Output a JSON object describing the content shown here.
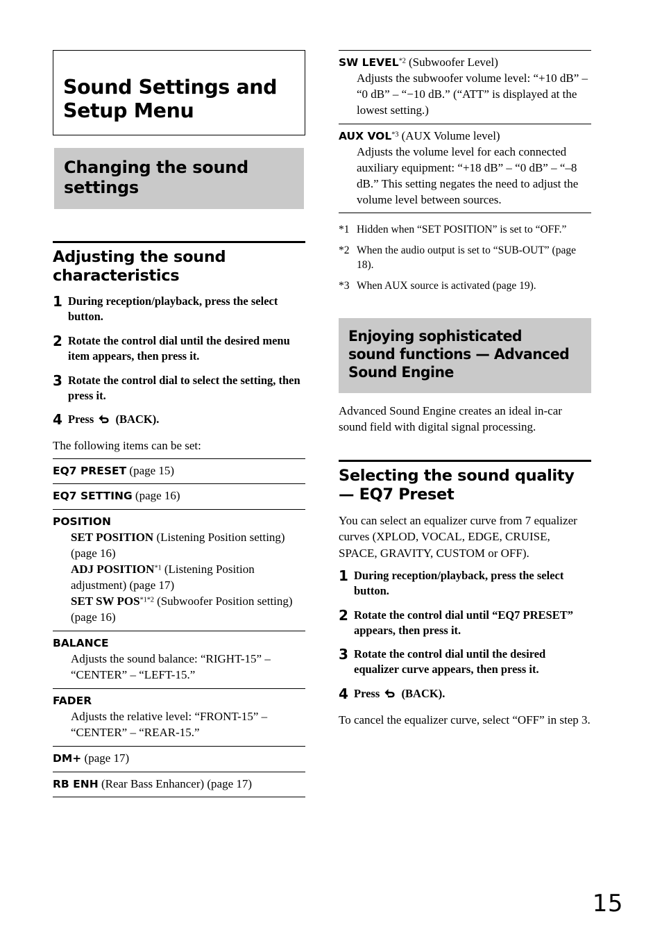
{
  "chapter": {
    "title": "Sound Settings and Setup Menu"
  },
  "left_column": {
    "banner": "Changing the sound settings",
    "section_title": "Adjusting the sound characteristics",
    "steps": [
      {
        "num": "1",
        "text": "During reception/playback, press the select button."
      },
      {
        "num": "2",
        "text": "Rotate the control dial until the desired menu item appears, then press it."
      },
      {
        "num": "3",
        "text": "Rotate the control dial to select the setting, then press it."
      },
      {
        "num": "4",
        "pre": "Press",
        "icon": "back-arrow-icon",
        "post": "(BACK)."
      }
    ],
    "intro": "The following items can be set:",
    "items": [
      {
        "name": "EQ7 PRESET",
        "suffix": " (page 15)",
        "sub": []
      },
      {
        "name": "EQ7 SETTING",
        "suffix": " (page 16)",
        "sub": []
      },
      {
        "name": "POSITION",
        "suffix": "",
        "sub": [
          {
            "label": "SET POSITION",
            "marks": "",
            "text": " (Listening Position setting) (page 16)"
          },
          {
            "label": "ADJ POSITION",
            "marks": "*1",
            "text": " (Listening Position adjustment) (page 17)"
          },
          {
            "label": "SET SW POS",
            "marks": "*1*2",
            "text": " (Subwoofer Position setting) (page 16)"
          }
        ]
      },
      {
        "name": "BALANCE",
        "suffix": "",
        "desc": "Adjusts the sound balance: “RIGHT-15” – “CENTER” – “LEFT-15.”",
        "sub": []
      },
      {
        "name": "FADER",
        "suffix": "",
        "desc": "Adjusts the relative level: “FRONT-15” – “CENTER” – “REAR-15.”",
        "sub": []
      },
      {
        "name": "DM+",
        "suffix": " (page 17)",
        "sub": []
      },
      {
        "name": "RB ENH",
        "suffix": " (Rear Bass Enhancer) (page 17)",
        "sub": []
      }
    ]
  },
  "right_column": {
    "items": [
      {
        "name": "SW LEVEL",
        "marks": "*2",
        "suffix": " (Subwoofer Level)",
        "desc": "Adjusts the subwoofer volume level: “+10 dB” – “0 dB” – “−10 dB.” (“ATT” is displayed at the lowest setting.)"
      },
      {
        "name": "AUX VOL",
        "marks": "*3",
        "suffix": " (AUX Volume level)",
        "desc": "Adjusts the volume level for each connected auxiliary equipment: “+18 dB” – “0 dB” – “–8 dB.” This setting negates the need to adjust the volume level between sources."
      }
    ],
    "footnotes": [
      {
        "mark": "*1",
        "text": "Hidden when “SET POSITION” is set to “OFF.”"
      },
      {
        "mark": "*2",
        "text": "When the audio output is set to “SUB-OUT” (page 18)."
      },
      {
        "mark": "*3",
        "text": "When AUX source is activated (page 19)."
      }
    ],
    "banner": "Enjoying sophisticated sound functions — Advanced Sound Engine",
    "banner_intro": "Advanced Sound Engine creates an ideal in-car sound field with digital signal processing.",
    "section_title": "Selecting the sound quality — EQ7 Preset",
    "section_intro": "You can select an equalizer curve from 7 equalizer curves (XPLOD, VOCAL, EDGE, CRUISE, SPACE, GRAVITY, CUSTOM or OFF).",
    "steps": [
      {
        "num": "1",
        "text": "During reception/playback, press the select button."
      },
      {
        "num": "2",
        "text": "Rotate the control dial until “EQ7 PRESET” appears, then press it."
      },
      {
        "num": "3",
        "text": "Rotate the control dial until the desired equalizer curve appears, then press it."
      },
      {
        "num": "4",
        "pre": "Press",
        "icon": "back-arrow-icon",
        "post": "(BACK)."
      }
    ],
    "outro": "To cancel the equalizer curve, select “OFF” in step 3."
  },
  "page_number": "15"
}
